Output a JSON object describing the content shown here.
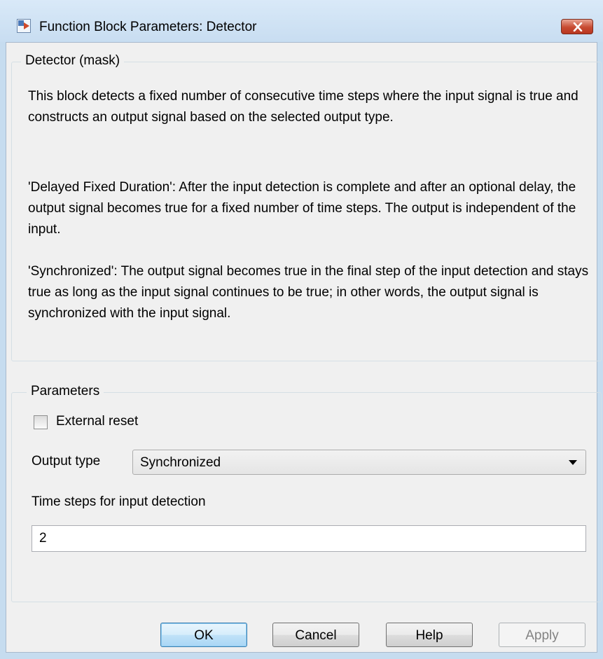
{
  "window": {
    "title": "Function Block Parameters: Detector"
  },
  "mask_group": {
    "legend": "Detector (mask)",
    "paragraphs": [
      "This block detects a fixed number of consecutive time steps where the input signal is true and constructs an output signal based on the selected output type.",
      "'Delayed Fixed Duration': After the input detection is complete and after an optional delay, the output signal becomes true for a fixed number of time steps. The output is independent of the input.",
      "'Synchronized': The output signal becomes true in the final step of the input detection and stays true as long as the input signal continues to be true; in other words, the output signal is synchronized with the input signal."
    ]
  },
  "params_group": {
    "legend": "Parameters",
    "external_reset": {
      "label": "External reset",
      "checked": false
    },
    "output_type": {
      "label": "Output type",
      "value": "Synchronized"
    },
    "time_steps": {
      "label": "Time steps for input detection",
      "value": "2"
    }
  },
  "buttons": {
    "ok": "OK",
    "cancel": "Cancel",
    "help": "Help",
    "apply": "Apply"
  },
  "icons": {
    "app": "simulink-block-icon",
    "close": "close-icon",
    "dropdown": "chevron-down-icon"
  }
}
